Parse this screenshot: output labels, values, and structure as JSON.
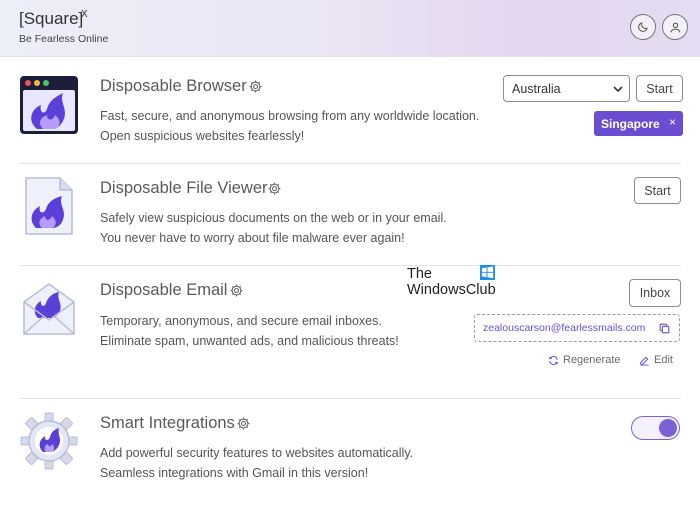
{
  "header": {
    "title": "[Square]",
    "title_sup": "X",
    "subtitle": "Be Fearless Online",
    "theme_icon": "moon-icon",
    "account_icon": "user-icon"
  },
  "features": [
    {
      "title": "Disposable Browser",
      "desc_line1": "Fast, secure, and anonymous browsing from any worldwide location.",
      "desc_line2": "Open suspicious websites fearlessly!",
      "location_select": "Australia",
      "start_label": "Start",
      "selected_chip": "Singapore",
      "chip_close": "×"
    },
    {
      "title": "Disposable File Viewer",
      "desc_line1": "Safely view suspicious documents on the web or in your email.",
      "desc_line2": "You never have to worry about file malware ever again!",
      "start_label": "Start"
    },
    {
      "title": "Disposable Email",
      "desc_line1": "Temporary, anonymous, and secure email inboxes.",
      "desc_line2": "Eliminate spam, unwanted ads, and malicious threats!",
      "inbox_label": "Inbox",
      "email": "zealouscarson@fearlessmails.com",
      "regenerate_label": "Regenerate",
      "edit_label": "Edit"
    },
    {
      "title": "Smart Integrations",
      "desc_line1": "Add powerful security features to websites automatically.",
      "desc_line2": "Seamless integrations with Gmail in this version!",
      "toggle_on": true
    }
  ],
  "watermark": {
    "line1": "The",
    "line2": "WindowsClub"
  },
  "colors": {
    "accent": "#6c4cd0",
    "flame_dark": "#5a3fd8",
    "flame_light": "#b79cff"
  }
}
